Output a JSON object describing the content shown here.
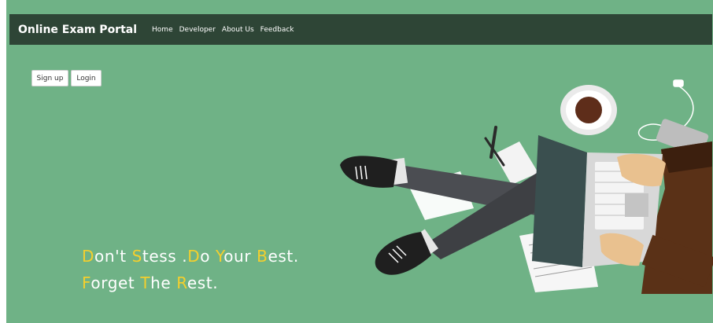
{
  "navbar": {
    "brand": "Online Exam Portal",
    "links": [
      "Home",
      "Developer",
      "About Us",
      "Feedback"
    ]
  },
  "actions": {
    "signup_label": "Sign up",
    "login_label": "Login"
  },
  "tagline": {
    "line1": [
      {
        "text": "D",
        "hl": true
      },
      {
        "text": "on't ",
        "hl": false
      },
      {
        "text": "S",
        "hl": true
      },
      {
        "text": "tess .",
        "hl": false
      },
      {
        "text": "D",
        "hl": true
      },
      {
        "text": "o ",
        "hl": false
      },
      {
        "text": "Y",
        "hl": true
      },
      {
        "text": "our ",
        "hl": false
      },
      {
        "text": "B",
        "hl": true
      },
      {
        "text": "est.",
        "hl": false
      }
    ],
    "line2": [
      {
        "text": "F",
        "hl": true
      },
      {
        "text": "orget ",
        "hl": false
      },
      {
        "text": "T",
        "hl": true
      },
      {
        "text": "he ",
        "hl": false
      },
      {
        "text": "R",
        "hl": true
      },
      {
        "text": "est.",
        "hl": false
      }
    ]
  },
  "colors": {
    "background": "#6fb286",
    "navbar": "#2e4536",
    "highlight": "#f4cf2d"
  },
  "hero": {
    "icon": "person-laptop-illustration"
  }
}
